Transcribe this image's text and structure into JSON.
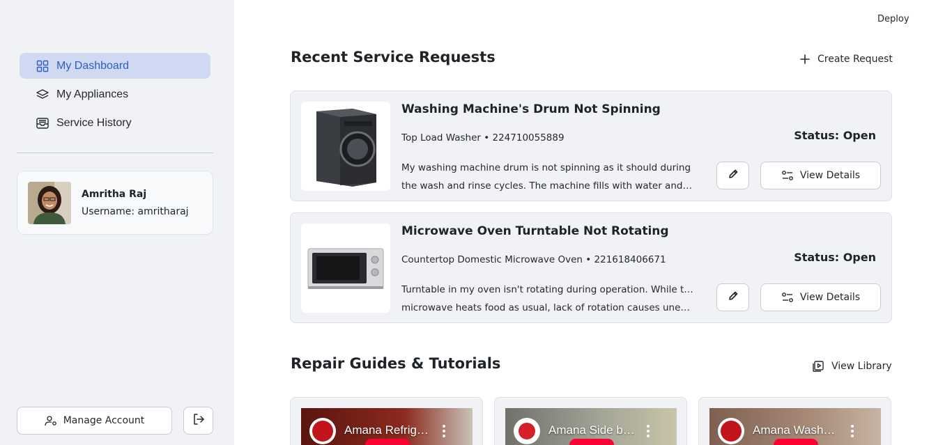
{
  "header": {
    "deploy_label": "Deploy"
  },
  "sidebar": {
    "nav": [
      {
        "label": "My Dashboard",
        "icon": "grid-icon",
        "active": true
      },
      {
        "label": "My Appliances",
        "icon": "layers-icon",
        "active": false
      },
      {
        "label": "Service History",
        "icon": "inbox-icon",
        "active": false
      }
    ],
    "profile": {
      "name": "Amritha Raj",
      "username": "Username: amritharaj"
    },
    "manage_account_label": "Manage Account",
    "logout_icon": "logout-icon"
  },
  "requests": {
    "title": "Recent Service Requests",
    "create_label": "Create Request",
    "items": [
      {
        "title": "Washing Machine's Drum Not Spinning",
        "meta": "Top Load Washer  •  224710055889",
        "desc_line1": "My washing machine drum is not spinning as it should during",
        "desc_line2": "the wash and rinse cycles. The machine fills with water and…",
        "status": "Status: Open",
        "details_label": "View Details"
      },
      {
        "title": "Microwave Oven Turntable Not Rotating",
        "meta": "Countertop Domestic Microwave Oven  •  221618406671",
        "desc_line1": "Turntable in my oven isn't rotating during operation. While the",
        "desc_line2": "microwave heats food as usual, lack of rotation causes uneve…",
        "status": "Status: Open",
        "details_label": "View Details"
      }
    ]
  },
  "guides": {
    "title": "Repair Guides & Tutorials",
    "library_label": "View Library",
    "videos": [
      {
        "title": "Amana Refrig…",
        "bg": "#6b1e16"
      },
      {
        "title": "Amana Side b…",
        "bg": "#8a8a80"
      },
      {
        "title": "Amana Wash…",
        "bg": "#9b7b6a"
      }
    ]
  },
  "colors": {
    "accent": "#2f5cc4",
    "active_bg": "#cfd9f2",
    "sidebar_bg": "#f0f2f6",
    "youtube_red": "#ff0033"
  }
}
